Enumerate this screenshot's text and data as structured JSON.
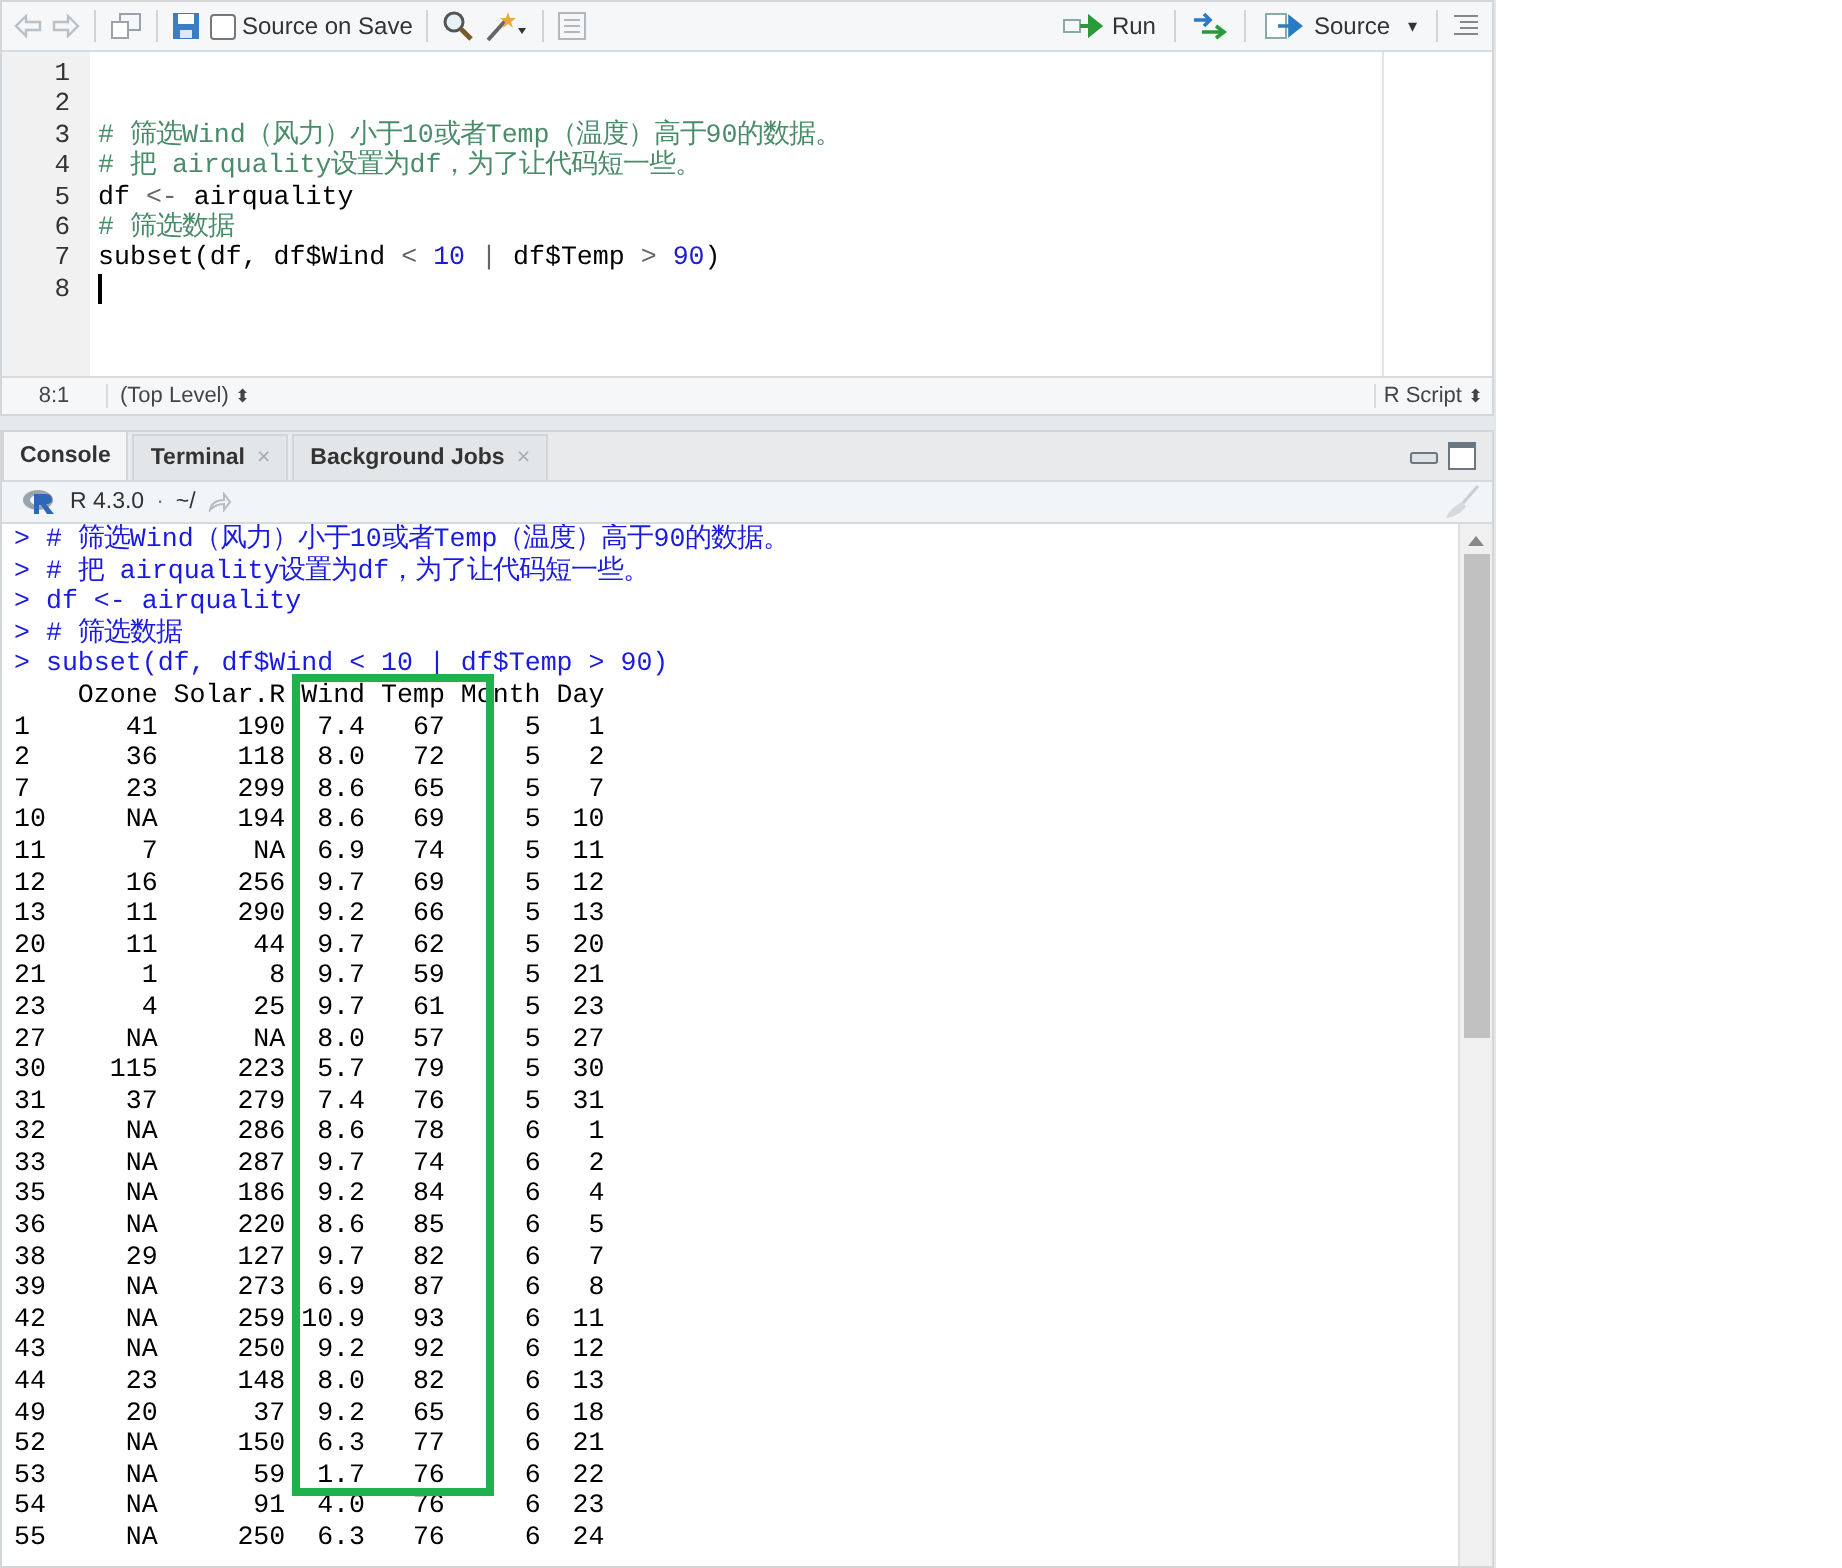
{
  "editor": {
    "toolbar": {
      "source_on_save": {
        "label": "Source on Save",
        "checked": false
      },
      "run": "Run",
      "source": "Source",
      "source_caret": "▾"
    },
    "lines": [
      {
        "number": "1"
      },
      {
        "number": "2"
      },
      {
        "number": "3",
        "tokens": [
          {
            "kind": "comment",
            "text": "# 筛选Wind（风力）小于10或者Temp（温度）高于90的数据。"
          }
        ]
      },
      {
        "number": "4",
        "tokens": [
          {
            "kind": "comment",
            "text": "# 把 airquality设置为df，为了让代码短一些。"
          }
        ]
      },
      {
        "number": "5",
        "tokens": [
          {
            "kind": "plain",
            "text": "df "
          },
          {
            "kind": "op",
            "text": "<- "
          },
          {
            "kind": "plain",
            "text": "airquality"
          }
        ]
      },
      {
        "number": "6",
        "tokens": [
          {
            "kind": "comment",
            "text": "# 筛选数据"
          }
        ]
      },
      {
        "number": "7",
        "tokens": [
          {
            "kind": "plain",
            "text": "subset(df, df$Wind "
          },
          {
            "kind": "op",
            "text": "< "
          },
          {
            "kind": "number",
            "text": "10 "
          },
          {
            "kind": "op",
            "text": "| "
          },
          {
            "kind": "plain",
            "text": "df$Temp "
          },
          {
            "kind": "op",
            "text": "> "
          },
          {
            "kind": "number",
            "text": "90"
          },
          {
            "kind": "plain",
            "text": ")"
          }
        ]
      },
      {
        "number": "8",
        "cursor": true
      }
    ],
    "status": {
      "position": "8:1",
      "scope": "(Top Level)",
      "scope_arrows": "⬍",
      "file_type": "R Script",
      "file_type_arrows": "⬍"
    }
  },
  "console": {
    "tabs": [
      {
        "label": "Console",
        "selected": true
      },
      {
        "label": "Terminal",
        "close": "×",
        "selected": false
      },
      {
        "label": "Background Jobs",
        "close": "×",
        "selected": false
      }
    ],
    "version": "R 4.3.0",
    "separator": "·",
    "path": "~/",
    "input": [
      {
        "prompt": ">",
        "text": "# 筛选Wind（风力）小于10或者Temp（温度）高于90的数据。"
      },
      {
        "prompt": ">",
        "text": "# 把 airquality设置为df，为了让代码短一些。"
      },
      {
        "prompt": ">",
        "text": "df <- airquality"
      },
      {
        "prompt": ">",
        "text": "# 筛选数据"
      },
      {
        "prompt": ">",
        "text": "subset(df, df$Wind < 10 | df$Temp > 90)"
      }
    ],
    "table": {
      "columns": [
        "",
        "Ozone",
        "Solar.R",
        "Wind",
        "Temp",
        "Month",
        "Day"
      ],
      "rows": [
        [
          "1",
          "41",
          "190",
          "7.4",
          "67",
          "5",
          "1"
        ],
        [
          "2",
          "36",
          "118",
          "8.0",
          "72",
          "5",
          "2"
        ],
        [
          "7",
          "23",
          "299",
          "8.6",
          "65",
          "5",
          "7"
        ],
        [
          "10",
          "NA",
          "194",
          "8.6",
          "69",
          "5",
          "10"
        ],
        [
          "11",
          "7",
          "NA",
          "6.9",
          "74",
          "5",
          "11"
        ],
        [
          "12",
          "16",
          "256",
          "9.7",
          "69",
          "5",
          "12"
        ],
        [
          "13",
          "11",
          "290",
          "9.2",
          "66",
          "5",
          "13"
        ],
        [
          "20",
          "11",
          "44",
          "9.7",
          "62",
          "5",
          "20"
        ],
        [
          "21",
          "1",
          "8",
          "9.7",
          "59",
          "5",
          "21"
        ],
        [
          "23",
          "4",
          "25",
          "9.7",
          "61",
          "5",
          "23"
        ],
        [
          "27",
          "NA",
          "NA",
          "8.0",
          "57",
          "5",
          "27"
        ],
        [
          "30",
          "115",
          "223",
          "5.7",
          "79",
          "5",
          "30"
        ],
        [
          "31",
          "37",
          "279",
          "7.4",
          "76",
          "5",
          "31"
        ],
        [
          "32",
          "NA",
          "286",
          "8.6",
          "78",
          "6",
          "1"
        ],
        [
          "33",
          "NA",
          "287",
          "9.7",
          "74",
          "6",
          "2"
        ],
        [
          "35",
          "NA",
          "186",
          "9.2",
          "84",
          "6",
          "4"
        ],
        [
          "36",
          "NA",
          "220",
          "8.6",
          "85",
          "6",
          "5"
        ],
        [
          "38",
          "29",
          "127",
          "9.7",
          "82",
          "6",
          "7"
        ],
        [
          "39",
          "NA",
          "273",
          "6.9",
          "87",
          "6",
          "8"
        ],
        [
          "42",
          "NA",
          "259",
          "10.9",
          "93",
          "6",
          "11"
        ],
        [
          "43",
          "NA",
          "250",
          "9.2",
          "92",
          "6",
          "12"
        ],
        [
          "44",
          "23",
          "148",
          "8.0",
          "82",
          "6",
          "13"
        ],
        [
          "49",
          "20",
          "37",
          "9.2",
          "65",
          "6",
          "18"
        ],
        [
          "52",
          "NA",
          "150",
          "6.3",
          "77",
          "6",
          "21"
        ],
        [
          "53",
          "NA",
          "59",
          "1.7",
          "76",
          "6",
          "22"
        ],
        [
          "54",
          "NA",
          "91",
          "4.0",
          "76",
          "6",
          "23"
        ],
        [
          "55",
          "NA",
          "250",
          "6.3",
          "76",
          "6",
          "24"
        ]
      ]
    }
  }
}
